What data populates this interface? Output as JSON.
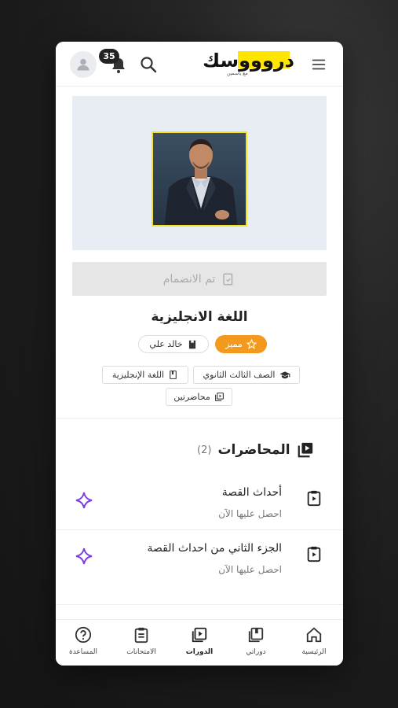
{
  "header": {
    "notification_count": "35",
    "logo_text": "دروووسك",
    "logo_subtext": "مع ياسمين"
  },
  "hero": {
    "join_status": "تم الانضمام"
  },
  "course": {
    "title": "اللغة الانجليزية",
    "premium_label": "مميز",
    "teacher": "خالد علي",
    "tags": {
      "grade": "الصف الثالث الثانوي",
      "subject": "اللغة الإنجليزية",
      "lectures": "محاضرتين"
    }
  },
  "lectures_section": {
    "title": "المحاضرات",
    "count": "(2)",
    "items": [
      {
        "title": "أحداث القصة",
        "subtitle": "احصل عليها الآن"
      },
      {
        "title": "الجزء الثاني من احداث القصة",
        "subtitle": "احصل عليها الآن"
      }
    ]
  },
  "bottom_nav": {
    "home": "الرئيسية",
    "my_courses": "دوراتي",
    "courses": "الدورات",
    "exams": "الامتحانات",
    "help": "المساعدة"
  },
  "colors": {
    "accent": "#f39a1e",
    "brand_yellow": "#ffe500",
    "sparkle": "#7b3fe4"
  }
}
